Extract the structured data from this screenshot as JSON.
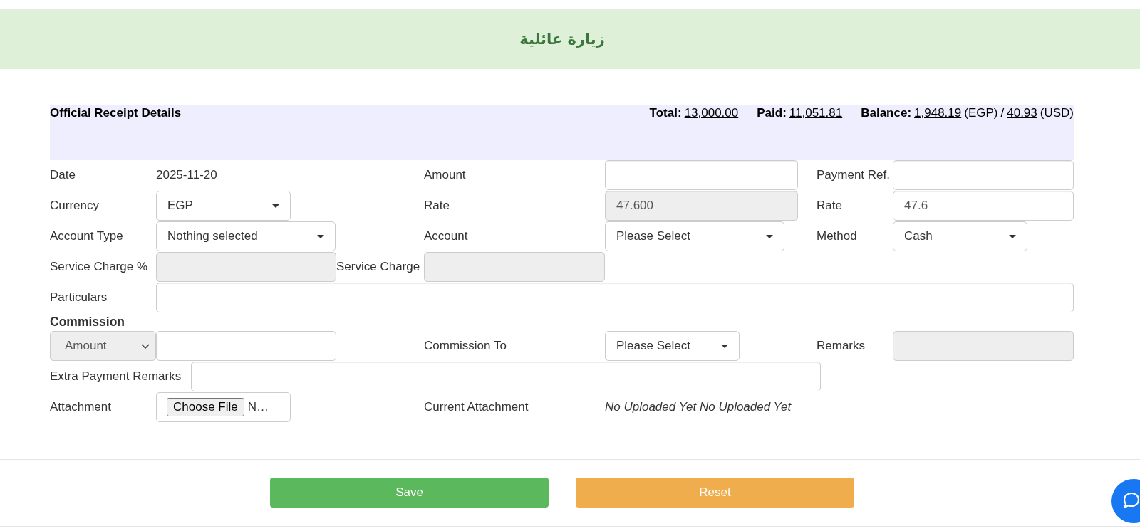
{
  "header": {
    "title": "زيارة عائلية"
  },
  "summary": {
    "title": "Official Receipt Details",
    "items": [
      {
        "label": "Total:",
        "amounts": [
          {
            "value": "13,000.00"
          }
        ]
      },
      {
        "label": "Paid:",
        "amounts": [
          {
            "value": "11,051.81"
          }
        ]
      },
      {
        "label": "Balance:",
        "separator": "/",
        "amounts": [
          {
            "value": "1,948.19",
            "currency": "(EGP)"
          },
          {
            "value": "40.93",
            "currency": "(USD)"
          }
        ]
      }
    ]
  },
  "form": {
    "rows": [
      {
        "kind": "fields",
        "fields": [
          {
            "label": "Date",
            "kind": "text",
            "value": "2025-11-20"
          },
          {
            "label": "Amount",
            "kind": "input",
            "disabled": false
          },
          {
            "label": "Payment Ref.",
            "kind": "input",
            "disabled": false
          }
        ]
      },
      {
        "kind": "fields",
        "fields": [
          {
            "label": "Currency",
            "kind": "select",
            "value": "EGP",
            "disabled": false
          },
          {
            "label": "Rate",
            "kind": "input",
            "value": "47.600",
            "disabled": true
          },
          {
            "label": "Rate",
            "kind": "input",
            "value": "47.6",
            "disabled": false
          }
        ]
      },
      {
        "kind": "fields",
        "fields": [
          {
            "label": "Account Type",
            "kind": "select",
            "value": "Nothing selected",
            "disabled": false
          },
          {
            "label": "Account",
            "kind": "select",
            "value": "Please Select",
            "disabled": false
          },
          {
            "label": "Method",
            "kind": "select",
            "value": "Cash",
            "disabled": false
          }
        ]
      },
      {
        "kind": "fields",
        "fields": [
          {
            "label": "Service Charge %",
            "kind": "input",
            "disabled": true
          },
          {
            "label": "Service Charge",
            "kind": "input",
            "disabled": true
          }
        ]
      },
      {
        "kind": "fields",
        "fields": [
          {
            "label": "Particulars",
            "kind": "input",
            "disabled": false
          }
        ]
      },
      {
        "kind": "heading",
        "text": "Commission"
      },
      {
        "kind": "fields",
        "fields": [
          {
            "kind": "native_select",
            "value": "Amount",
            "disabled": true
          },
          {
            "kind": "input",
            "disabled": false
          },
          {
            "label": "Commission To",
            "kind": "select",
            "value": "Please Select",
            "disabled": false
          },
          {
            "label": "Remarks",
            "kind": "input",
            "disabled": true
          }
        ]
      },
      {
        "kind": "fields",
        "fields": [
          {
            "label": "Extra Payment Remarks",
            "kind": "input",
            "disabled": false
          }
        ]
      },
      {
        "kind": "fields",
        "fields": [
          {
            "label": "Attachment",
            "kind": "file",
            "button": "Choose File",
            "value": "N…"
          },
          {
            "label": "Current Attachment",
            "kind": "note",
            "value": "No Uploaded Yet No Uploaded Yet"
          }
        ]
      }
    ]
  },
  "footer": {
    "buttons": [
      {
        "label": "Save",
        "kind": "success"
      },
      {
        "label": "Reset",
        "kind": "warning"
      }
    ]
  }
}
